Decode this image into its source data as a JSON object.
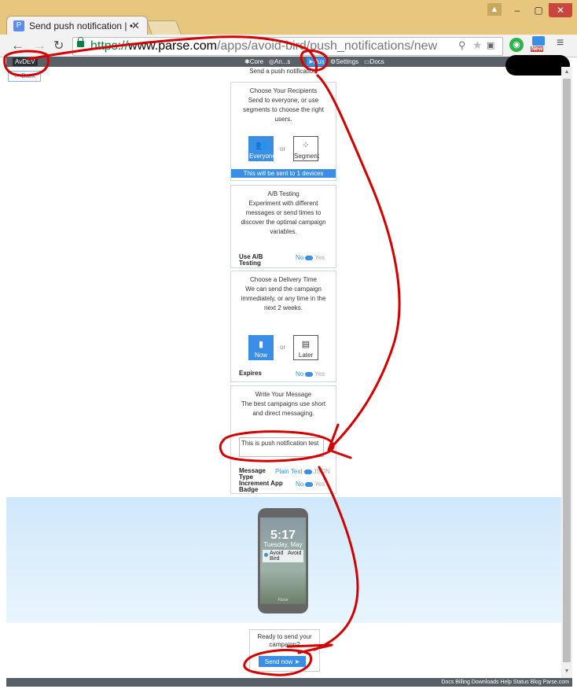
{
  "browser": {
    "tab_title": "Send push notification | •",
    "tab_favicon": "P",
    "url_protocol": "https://",
    "url_host": "www.parse.com",
    "url_path": "/apps/avoid-bird/push_notifications/new",
    "new_badge": "New"
  },
  "app_nav": {
    "app_name": "AvDEV",
    "items": [
      {
        "label": "✱Core"
      },
      {
        "label": "◎An...s"
      },
      {
        "label": "➤Pus"
      },
      {
        "label": "⚙Settings"
      },
      {
        "label": "▭Docs"
      }
    ]
  },
  "page": {
    "back_label": "← Back",
    "title": "Send a push notification"
  },
  "recipients": {
    "text": "Choose Your Recipients\nSend to everyone, or use segments to choose the right users.",
    "option_everyone": "Everyone",
    "option_segment": "Segment",
    "or": "or",
    "summary": "This will be sent to 1 devices"
  },
  "ab_testing": {
    "text": "A/B Testing\nExperiment with different messages or send times to\ndiscover the optimal campaign variables.",
    "label": "Use A/B Testing",
    "no": "No",
    "yes": "Yes"
  },
  "delivery": {
    "text": "Choose a Delivery Time\nWe can send the campaign immediately, or any time in the next 2 weeks.",
    "option_now": "Now",
    "option_later": "Later",
    "or": "or",
    "expires_label": "Expires",
    "no": "No",
    "yes": "Yes"
  },
  "message": {
    "text": "Write Your Message\nThe best campaigns use short and direct messaging.",
    "value": "This is push notification test",
    "type_label": "Message Type",
    "type_plain": "Plain Text",
    "type_json": "JSON",
    "badge_label": "Increment App Badge",
    "no": "No",
    "yes": "Yes"
  },
  "preview": {
    "time": "5:17",
    "date": "Tuesday, May",
    "app_name": "Avoid Bird",
    "notif_text": "Avoid",
    "phone_brand": "Parse"
  },
  "send": {
    "ready_text": "Ready to send your campaign?",
    "button": "Send now"
  },
  "footer": {
    "links": "Docs Billing Downloads Help Status Blog Parse.com"
  },
  "colors": {
    "accent": "#3b8ee6",
    "annotation": "#d40000",
    "chrome_frame": "#e7c67e"
  }
}
